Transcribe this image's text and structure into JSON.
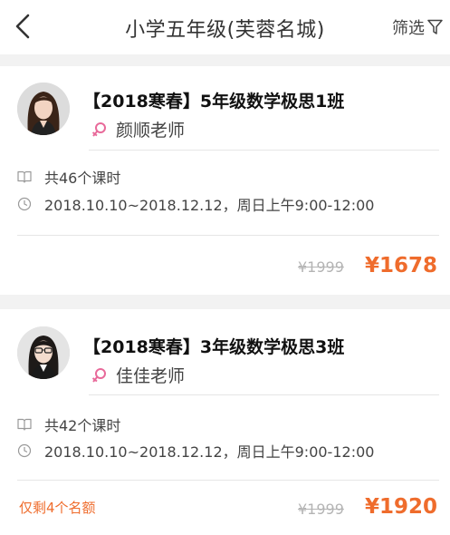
{
  "header": {
    "title": "小学五年级(芙蓉名城)",
    "filter_label": "筛选"
  },
  "colors": {
    "accent": "#ef6c2c",
    "gender_icon": "#e86a9a"
  },
  "courses": [
    {
      "title": "【2018寒春】5年级数学极思1班",
      "teacher": "颜顺老师",
      "lessons": "共46个课时",
      "schedule": "2018.10.10~2018.12.12，周日上午9:00-12:00",
      "original_price": "¥1999",
      "price": "¥1678",
      "quota": ""
    },
    {
      "title": "【2018寒春】3年级数学极思3班",
      "teacher": "佳佳老师",
      "lessons": "共42个课时",
      "schedule": "2018.10.10~2018.12.12，周日上午9:00-12:00",
      "original_price": "¥1999",
      "price": "¥1920",
      "quota": "仅剩4个名额"
    }
  ]
}
